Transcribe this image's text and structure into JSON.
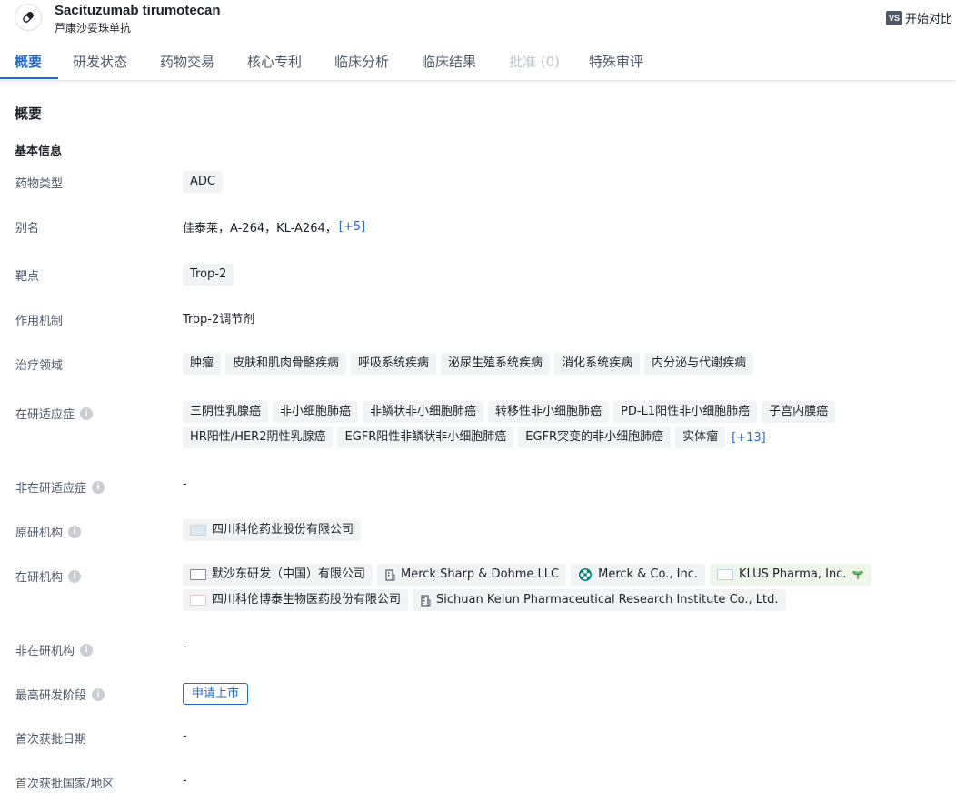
{
  "header": {
    "drug_name": "Sacituzumab tirumotecan",
    "drug_cn_name": "芦康沙妥珠单抗",
    "compare_badge": "VS",
    "compare_label": "开始对比"
  },
  "tabs": [
    {
      "label": "概要"
    },
    {
      "label": "研发状态"
    },
    {
      "label": "药物交易"
    },
    {
      "label": "核心专利"
    },
    {
      "label": "临床分析"
    },
    {
      "label": "临床结果"
    },
    {
      "label": "批准 (0)"
    },
    {
      "label": "特殊审评"
    }
  ],
  "overview": {
    "section_title": "概要",
    "basic_info_title": "基本信息",
    "drug_type": {
      "label": "药物类型",
      "values": [
        "ADC"
      ]
    },
    "aliases": {
      "label": "别名",
      "text": "佳泰莱，A-264，KL-A264，",
      "more": "[+5]"
    },
    "target": {
      "label": "靶点",
      "values": [
        "Trop-2"
      ]
    },
    "mechanism": {
      "label": "作用机制",
      "text": "Trop-2调节剂"
    },
    "therapeutic_areas": {
      "label": "治疗领域",
      "values": [
        "肿瘤",
        "皮肤和肌肉骨骼疾病",
        "呼吸系统疾病",
        "泌尿生殖系统疾病",
        "消化系统疾病",
        "内分泌与代谢疾病"
      ]
    },
    "active_indications": {
      "label": "在研适应症",
      "values": [
        "三阴性乳腺癌",
        "非小细胞肺癌",
        "非鳞状非小细胞肺癌",
        "转移性非小细胞肺癌",
        "PD-L1阳性非小细胞肺癌",
        "子宫内膜癌",
        "HR阳性/HER2阴性乳腺癌",
        "EGFR阳性非鳞状非小细胞肺癌",
        "EGFR突变的非小细胞肺癌",
        "实体瘤"
      ],
      "more": "[+13]"
    },
    "inactive_indications": {
      "label": "非在研适应症",
      "value": "-"
    },
    "originator": {
      "label": "原研机构",
      "orgs": [
        "四川科伦药业股份有限公司"
      ]
    },
    "active_orgs": {
      "label": "在研机构",
      "orgs": [
        "默沙东研发（中国）有限公司",
        "Merck Sharp & Dohme LLC",
        "Merck & Co., Inc.",
        "KLUS Pharma, Inc.",
        "四川科伦博泰生物医药股份有限公司",
        "Sichuan Kelun Pharmaceutical Research Institute Co., Ltd."
      ]
    },
    "inactive_orgs": {
      "label": "非在研机构",
      "value": "-"
    },
    "highest_phase": {
      "label": "最高研发阶段",
      "value": "申请上市"
    },
    "first_approval_date": {
      "label": "首次获批日期",
      "value": "-"
    },
    "first_approval_region": {
      "label": "首次获批国家/地区",
      "value": "-"
    }
  },
  "colors": {
    "accent": "#1f6bd1",
    "tag_bg": "#f2f3f5",
    "label_text": "#4e5969"
  }
}
